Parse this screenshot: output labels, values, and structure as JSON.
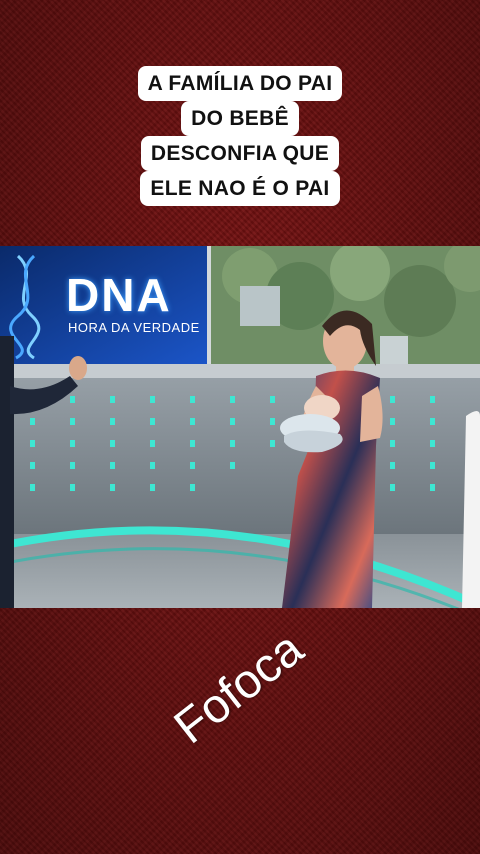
{
  "caption": {
    "lines": [
      "A FAMÍLIA DO PAI",
      "DO BEBÊ",
      "DESCONFIA QUE",
      "ELE NAO É O PAI"
    ]
  },
  "video": {
    "logo_title": "DNA",
    "logo_subtitle": "HORA DA VERDADE"
  },
  "watermark": "Fofoca",
  "colors": {
    "background": "#7a1212",
    "caption_bg": "#ffffff",
    "caption_text": "#111111",
    "studio_accent": "#3ee6d2"
  }
}
